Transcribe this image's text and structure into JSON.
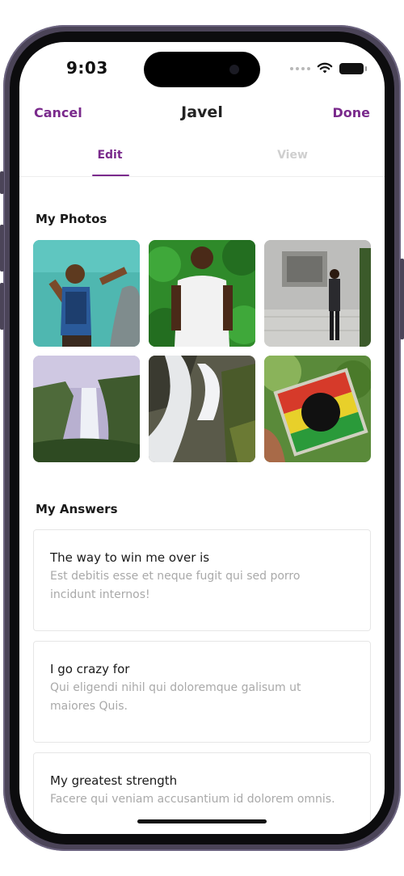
{
  "status_bar": {
    "time": "9:03"
  },
  "nav": {
    "cancel_label": "Cancel",
    "title": "Javel",
    "done_label": "Done"
  },
  "tabs": [
    {
      "label": "Edit",
      "active": true
    },
    {
      "label": "View",
      "active": false
    }
  ],
  "photos_section": {
    "heading": "My Photos",
    "photos": [
      {
        "subject": "man-in-life-vest-by-water"
      },
      {
        "subject": "man-in-white-shirt-foliage"
      },
      {
        "subject": "man-by-stone-monument"
      },
      {
        "subject": "waterfall-valley"
      },
      {
        "subject": "waterfall-rocks"
      },
      {
        "subject": "hand-holding-cd-case"
      }
    ]
  },
  "answers_section": {
    "heading": "My Answers",
    "answers": [
      {
        "question": "The way to win me over is",
        "answer": "Est debitis esse et neque fugit qui sed porro incidunt internos!"
      },
      {
        "question": "I go crazy for",
        "answer": "Qui eligendi nihil qui doloremque galisum ut maiores Quis."
      },
      {
        "question": "My greatest strength",
        "answer": "Facere qui veniam accusantium id dolorem omnis."
      }
    ]
  },
  "colors": {
    "accent": "#7a2a8c",
    "inactive_tab": "#cfcfcf",
    "answer_text": "#a9a9a9"
  },
  "icons": {
    "wifi": "wifi-icon",
    "battery": "battery-icon",
    "signal": "signal-dots-icon"
  }
}
